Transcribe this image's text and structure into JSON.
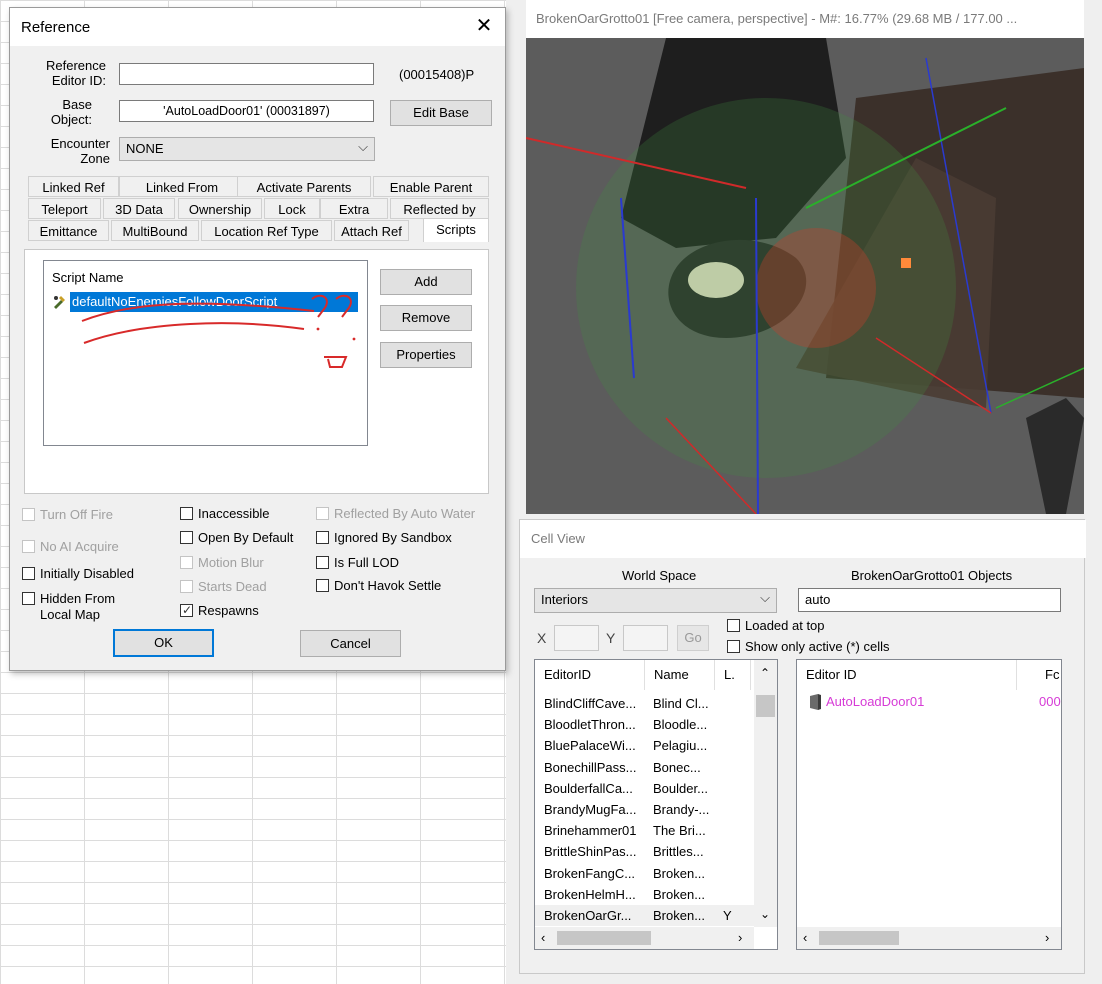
{
  "reference_dialog": {
    "title": "Reference",
    "close_glyph": "✕",
    "editor_id_label": "Reference Editor ID:",
    "editor_id_value": "",
    "form_id": "(00015408)P",
    "base_object_label": "Base Object:",
    "base_object_value": "'AutoLoadDoor01' (00031897)",
    "edit_base_label": "Edit Base",
    "encounter_zone_label": "Encounter Zone",
    "encounter_zone_value": "NONE",
    "tabs_row1": [
      "Linked Ref",
      "Linked From",
      "Activate Parents",
      "Enable Parent"
    ],
    "tabs_row2": [
      "Teleport",
      "3D Data",
      "Ownership",
      "Lock",
      "Extra",
      "Reflected by"
    ],
    "tabs_row3": [
      "Emittance",
      "MultiBound",
      "Location Ref Type",
      "Attach Ref",
      "Scripts"
    ],
    "active_tab": "Scripts",
    "script_list_header": "Script Name",
    "scripts": [
      "defaultNoEnemiesFollowDoorScript"
    ],
    "add_label": "Add",
    "remove_label": "Remove",
    "properties_label": "Properties",
    "checkboxes_left": [
      {
        "label": "Turn Off Fire",
        "checked": false,
        "disabled": true
      },
      {
        "label": "No AI Acquire",
        "checked": false,
        "disabled": true
      },
      {
        "label": "Initially Disabled",
        "checked": false,
        "disabled": false
      },
      {
        "label": "Hidden From Local Map",
        "checked": false,
        "disabled": false
      }
    ],
    "checkboxes_mid": [
      {
        "label": "Inaccessible",
        "checked": false,
        "disabled": false
      },
      {
        "label": "Open By Default",
        "checked": false,
        "disabled": false
      },
      {
        "label": "Motion Blur",
        "checked": false,
        "disabled": true
      },
      {
        "label": "Starts Dead",
        "checked": false,
        "disabled": true
      },
      {
        "label": "Respawns",
        "checked": true,
        "disabled": false
      }
    ],
    "checkboxes_right": [
      {
        "label": "Reflected By Auto Water",
        "checked": false,
        "disabled": true
      },
      {
        "label": "Ignored By Sandbox",
        "checked": false,
        "disabled": false
      },
      {
        "label": "Is Full LOD",
        "checked": false,
        "disabled": false
      },
      {
        "label": "Don't Havok Settle",
        "checked": false,
        "disabled": false
      }
    ],
    "ok_label": "OK",
    "cancel_label": "Cancel"
  },
  "viewport": {
    "title": "BrokenOarGrotto01 [Free camera, perspective] - M#: 16.77% (29.68 MB / 177.00 ..."
  },
  "cell_view": {
    "title": "Cell View",
    "world_space_label": "World Space",
    "world_space_value": "Interiors",
    "objects_label": "BrokenOarGrotto01 Objects",
    "filter_value": "auto",
    "x_label": "X",
    "y_label": "Y",
    "go_label": "Go",
    "loaded_at_top_label": "Loaded at top",
    "show_active_label": "Show only active (*) cells",
    "cell_columns": [
      "EditorID",
      "Name",
      "L."
    ],
    "cells": [
      [
        "BlindCliffCave...",
        "Blind Cl...",
        ""
      ],
      [
        "BloodletThron...",
        "Bloodle...",
        ""
      ],
      [
        "BluePalaceWi...",
        "Pelagiu...",
        ""
      ],
      [
        "BonechillPass...",
        "Bonec...",
        ""
      ],
      [
        "BoulderfallCa...",
        "Boulder...",
        ""
      ],
      [
        "BrandyMugFa...",
        "Brandy-...",
        ""
      ],
      [
        "Brinehammer01",
        "The Bri...",
        ""
      ],
      [
        "BrittleShinPas...",
        "Brittles...",
        ""
      ],
      [
        "BrokenFangC...",
        "Broken...",
        ""
      ],
      [
        "BrokenHelmH...",
        "Broken...",
        ""
      ],
      [
        "BrokenOarGr...",
        "Broken...",
        "Y"
      ]
    ],
    "object_columns": [
      "Editor ID",
      "Fc"
    ],
    "objects": [
      {
        "editor_id": "AutoLoadDoor01",
        "form": "000"
      }
    ],
    "accent_color": "#d63bd6"
  }
}
